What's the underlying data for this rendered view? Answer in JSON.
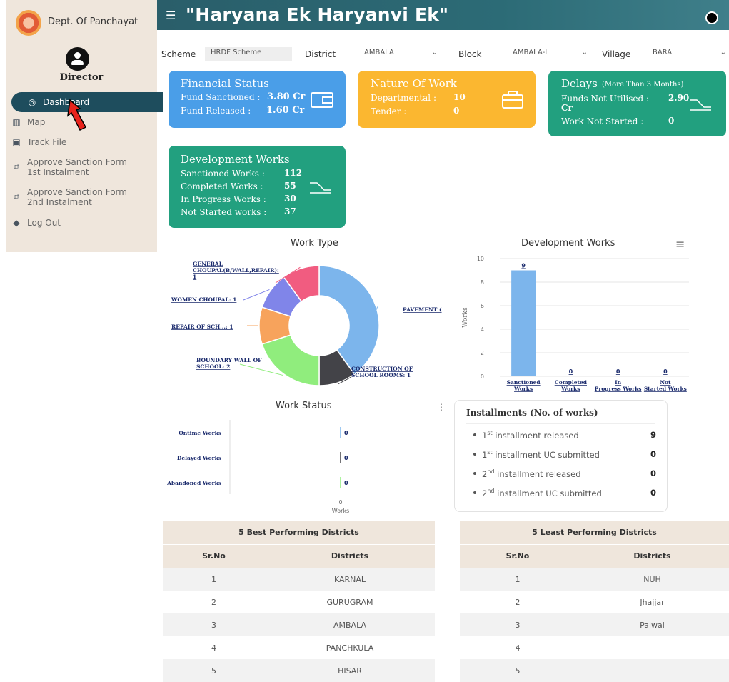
{
  "sidebar": {
    "dept": "Dept. Of Panchayat",
    "role": "Director",
    "items": [
      {
        "label": "Dashboard",
        "icon": "dashboard-icon"
      },
      {
        "label": "Map",
        "icon": "map-icon"
      },
      {
        "label": "Track File",
        "icon": "track-file-icon"
      },
      {
        "label_1": "Approve Sanction Form",
        "label_2": "1st Instalment",
        "icon": "form-icon"
      },
      {
        "label_1": "Approve Sanction Form",
        "label_2": "2nd Instalment",
        "icon": "form-icon"
      },
      {
        "label": "Log Out",
        "icon": "logout-icon"
      }
    ]
  },
  "header": {
    "title": "\"Haryana Ek Haryanvi Ek\""
  },
  "filters": {
    "scheme_label": "Scheme",
    "scheme_value": "HRDF Scheme",
    "district_label": "District",
    "district_value": "AMBALA",
    "block_label": "Block",
    "block_value": "AMBALA-I",
    "village_label": "Village",
    "village_value": "BARA"
  },
  "cards": {
    "financial": {
      "title": "Financial Status",
      "sanctioned_label": "Fund Sanctioned :",
      "sanctioned_value": "3.80 Cr",
      "released_label": "Fund Released :",
      "released_value": "1.60 Cr"
    },
    "nature": {
      "title": "Nature Of Work",
      "departmental_label": "Departmental :",
      "departmental_value": "10",
      "tender_label": "Tender :",
      "tender_value": "0"
    },
    "delays": {
      "title": "Delays",
      "subtitle": "(More Than 3 Months)",
      "funds_label": "Funds Not Utilised :",
      "funds_value": "2.90",
      "funds_unit": "Cr",
      "notstarted_label": "Work Not Started :",
      "notstarted_value": "0"
    },
    "development": {
      "title": "Development Works",
      "sanctioned_label": "Sanctioned Works :",
      "sanctioned_value": "112",
      "completed_label": "Completed Works :",
      "completed_value": "55",
      "inprogress_label": "In Progress Works :",
      "inprogress_value": "30",
      "notstarted_label": "Not Started works :",
      "notstarted_value": "37"
    }
  },
  "chart_data": [
    {
      "type": "pie",
      "title": "Work Type",
      "labels_text": [
        "PAVEMENT (",
        "CONSTRUCTION OF SCHOOL ROOMS: 1",
        "BOUNDARY WALL OF SCHOOL: 2",
        "REPAIR OF SCH...: 1",
        "WOMEN CHOUPAL: 1",
        "GENERAL CHOUPAL(B/WALL,REPAIR): 1"
      ],
      "values": [
        4,
        1,
        2,
        1,
        1,
        1
      ],
      "colors": [
        "#7cb5ec",
        "#434348",
        "#90ed7d",
        "#f7a35c",
        "#8085e9",
        "#f15c80"
      ]
    },
    {
      "type": "bar",
      "title": "Development Works",
      "categories": [
        "Sanctioned Works",
        "Completed Works",
        "In Progress Works",
        "Not Started Works"
      ],
      "values": [
        9,
        0,
        0,
        0
      ],
      "ylabel": "Works",
      "ylim": [
        0,
        10
      ],
      "yticks": [
        0,
        2,
        4,
        6,
        8,
        10
      ],
      "color": "#7cb5ec"
    },
    {
      "type": "bar",
      "orientation": "horizontal",
      "title": "Work Status",
      "categories": [
        "Ontime Works",
        "Delayed Works",
        "Abandoned Works"
      ],
      "values": [
        0,
        0,
        0
      ],
      "xlabel": "Works",
      "xticks": [
        0
      ],
      "colors": [
        "#7cb5ec",
        "#434348",
        "#90ed7d"
      ]
    }
  ],
  "installments": {
    "title": "Installments (No. of works)",
    "rows": [
      {
        "ord": "1",
        "sup": "st",
        "text": " installment released",
        "value": "9"
      },
      {
        "ord": "1",
        "sup": "st",
        "text": " installment UC submitted",
        "value": "0"
      },
      {
        "ord": "2",
        "sup": "nd",
        "text": " installment released",
        "value": "0"
      },
      {
        "ord": "2",
        "sup": "nd",
        "text": " installment UC submitted",
        "value": "0"
      }
    ]
  },
  "best_table": {
    "title": "5 Best Performing Districts",
    "headers": [
      "Sr.No",
      "Districts"
    ],
    "rows": [
      [
        "1",
        "KARNAL"
      ],
      [
        "2",
        "GURUGRAM"
      ],
      [
        "3",
        "AMBALA"
      ],
      [
        "4",
        "PANCHKULA"
      ],
      [
        "5",
        "HISAR"
      ]
    ]
  },
  "least_table": {
    "title": "5 Least Performing Districts",
    "headers": [
      "Sr.No",
      "Districts"
    ],
    "rows": [
      [
        "1",
        "NUH"
      ],
      [
        "2",
        "Jhajjar"
      ],
      [
        "3",
        "Palwal"
      ],
      [
        "4",
        ""
      ],
      [
        "5",
        ""
      ]
    ]
  },
  "colors": {
    "sidebar_active": "#1e4d5d",
    "header": "#2c6b76",
    "blue_card": "#4a9ee8",
    "amber_card": "#fbb730",
    "teal_card": "#22a07f",
    "table_head": "#efe6dc"
  }
}
